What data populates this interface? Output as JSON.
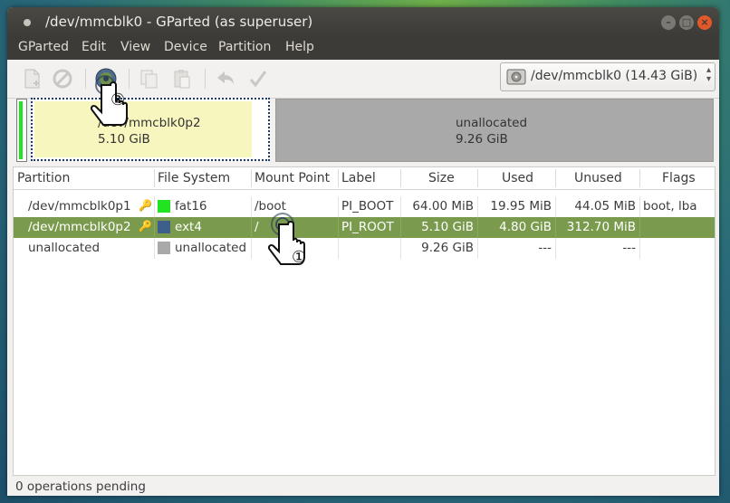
{
  "window": {
    "title": "/dev/mmcblk0 - GParted (as superuser)"
  },
  "menu": [
    "GParted",
    "Edit",
    "View",
    "Device",
    "Partition",
    "Help"
  ],
  "toolbar": {
    "icons": [
      "new-partition-icon",
      "delete-icon",
      "resize-move-icon",
      "copy-icon",
      "paste-icon",
      "undo-icon",
      "apply-icon"
    ]
  },
  "device_selector": {
    "value": "/dev/mmcblk0  (14.43 GiB)"
  },
  "partition_map": {
    "selected": {
      "name": "/dev/mmcblk0p2",
      "size": "5.10 GiB"
    },
    "unallocated": {
      "name": "unallocated",
      "size": "9.26 GiB"
    }
  },
  "table": {
    "columns": [
      "Partition",
      "File System",
      "Mount Point",
      "Label",
      "Size",
      "Used",
      "Unused",
      "Flags"
    ],
    "rows": [
      {
        "partition": "/dev/mmcblk0p1",
        "fs": "fat16",
        "fs_color": "#22e322",
        "mount": "/boot",
        "label": "PI_BOOT",
        "size": "64.00 MiB",
        "used": "19.95 MiB",
        "unused": "44.05 MiB",
        "flags": "boot, lba",
        "selected": false
      },
      {
        "partition": "/dev/mmcblk0p2",
        "fs": "ext4",
        "fs_color": "#3d5f8a",
        "mount": "/",
        "label": "PI_ROOT",
        "size": "5.10 GiB",
        "used": "4.80 GiB",
        "unused": "312.70 MiB",
        "flags": "",
        "selected": true
      },
      {
        "partition": "unallocated",
        "fs": "unallocated",
        "fs_color": "#a9a9a9",
        "mount": "",
        "label": "",
        "size": "9.26 GiB",
        "used": "---",
        "unused": "---",
        "flags": "",
        "selected": false
      }
    ]
  },
  "annotations": {
    "step1": "①",
    "step2": "②"
  },
  "status": {
    "text": "0 operations pending"
  }
}
